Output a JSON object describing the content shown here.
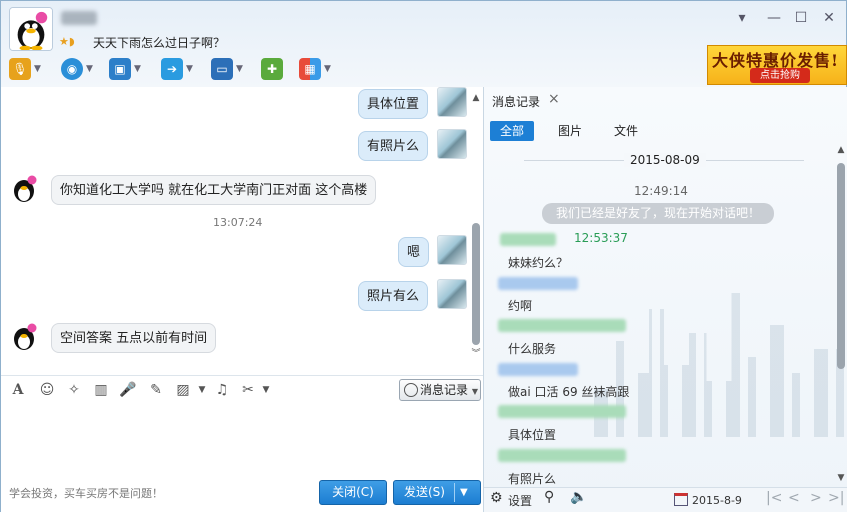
{
  "window": {
    "signature": "天天下雨怎么过日子啊？",
    "controls": {
      "menu": "▾",
      "minimize": "—",
      "maximize": "☐",
      "close": "✕"
    }
  },
  "toolbar": {
    "items": [
      {
        "icon": "microphone-icon",
        "glyph": "🎙"
      },
      {
        "icon": "camera-icon",
        "glyph": "◉"
      },
      {
        "icon": "screen-share-icon",
        "glyph": "▣"
      },
      {
        "icon": "file-transfer-icon",
        "glyph": "➔"
      },
      {
        "icon": "remote-desktop-icon",
        "glyph": "▭"
      },
      {
        "icon": "group-chat-icon",
        "glyph": "✚"
      },
      {
        "icon": "apps-icon",
        "glyph": "▦"
      }
    ]
  },
  "ad": {
    "title": "大侠特惠价发售!",
    "button": "点击抢购"
  },
  "chat": {
    "messages": [
      {
        "from": "me",
        "text": "具体位置"
      },
      {
        "from": "me",
        "text": "有照片么"
      },
      {
        "from": "other",
        "text": "你知道化工大学吗  就在化工大学南门正对面 这个高楼"
      },
      {
        "type": "time",
        "text": "13:07:24"
      },
      {
        "from": "me",
        "text": "嗯"
      },
      {
        "from": "me",
        "text": "照片有么"
      },
      {
        "from": "other",
        "text": "空间答案 五点以前有时间"
      }
    ]
  },
  "input": {
    "tools": [
      {
        "icon": "font-icon",
        "glyph": "A"
      },
      {
        "icon": "emoji-icon",
        "glyph": "☺"
      },
      {
        "icon": "magic-icon",
        "glyph": "✧"
      },
      {
        "icon": "video-clip-icon",
        "glyph": "▥"
      },
      {
        "icon": "voice-icon",
        "glyph": "🎤"
      },
      {
        "icon": "edit-icon",
        "glyph": "✎"
      },
      {
        "icon": "image-icon",
        "glyph": "▨"
      },
      {
        "icon": "music-icon",
        "glyph": "♫"
      },
      {
        "icon": "scissors-icon",
        "glyph": "✂"
      }
    ],
    "history_button": "消息记录",
    "hint": "学会投资，买车买房不是问题！",
    "close_button": "关闭(C)",
    "send_button": "发送(S)"
  },
  "history": {
    "tab": "消息记录",
    "filters": [
      "全部",
      "图片",
      "文件"
    ],
    "date": "2015-08-09",
    "time1": "12:49:14",
    "system_message": "我们已经是好友了，现在开始对话吧！",
    "time2": "12:53:37",
    "entries": [
      "妹妹约么？",
      "约啊",
      "什么服务",
      "做ai 口活  69 丝袜高跟",
      "具体位置",
      "有照片么"
    ],
    "bottom": {
      "settings": "设置",
      "date": "2015-8-9"
    }
  }
}
